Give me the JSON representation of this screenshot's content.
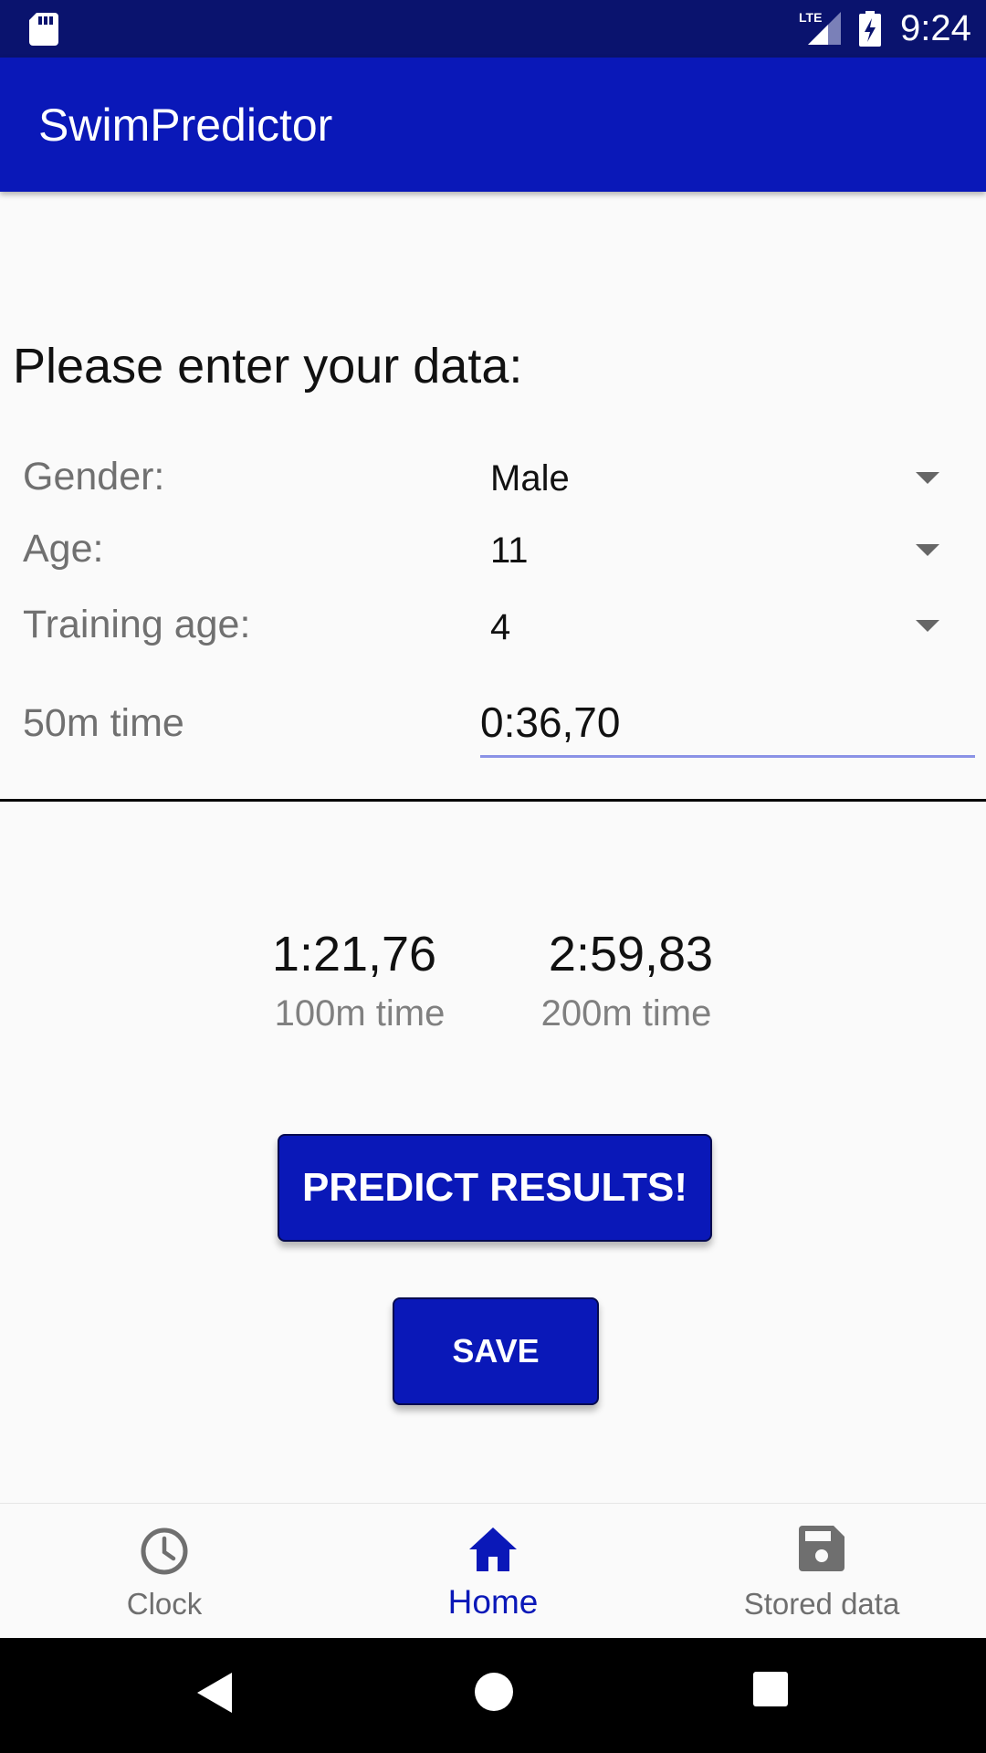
{
  "status_bar": {
    "time": "9:24",
    "network_label": "LTE",
    "icons": [
      "sd-card-icon",
      "lte-signal-icon",
      "battery-charging-icon"
    ]
  },
  "app_bar": {
    "title": "SwimPredictor"
  },
  "form": {
    "heading": "Please enter your data:",
    "gender": {
      "label": "Gender:",
      "value": "Male"
    },
    "age": {
      "label": "Age:",
      "value": "11"
    },
    "training_age": {
      "label": "Training age:",
      "value": "4"
    },
    "time_50m": {
      "label": "50m time",
      "value": "0:36,70"
    }
  },
  "results": {
    "r100": {
      "value": "1:21,76",
      "label": "100m time"
    },
    "r200": {
      "value": "2:59,83",
      "label": "200m time"
    }
  },
  "buttons": {
    "predict": "PREDICT RESULTS!",
    "save": "SAVE"
  },
  "bottom_nav": {
    "items": [
      {
        "label": "Clock",
        "icon": "clock-icon",
        "active": false
      },
      {
        "label": "Home",
        "icon": "home-icon",
        "active": true
      },
      {
        "label": "Stored data",
        "icon": "save-icon",
        "active": false
      }
    ]
  },
  "colors": {
    "status_bar": "#0a136e",
    "primary": "#0a18b8",
    "input_underline": "#8a92e6",
    "label_gray": "#707070"
  }
}
